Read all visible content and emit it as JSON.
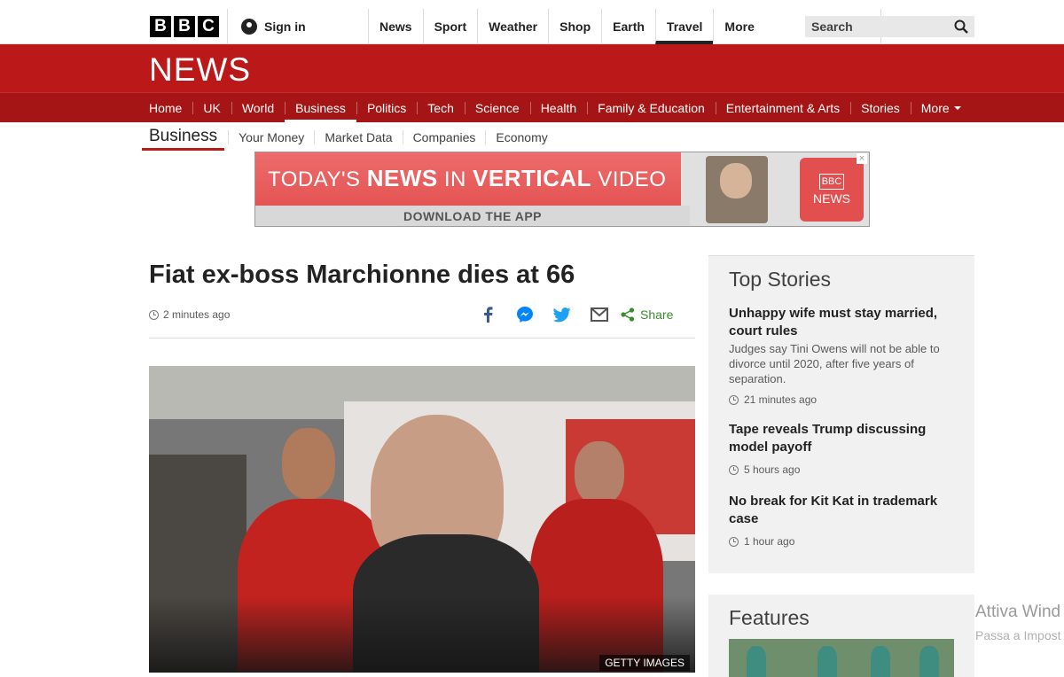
{
  "brand": {
    "logo_letters": [
      "B",
      "B",
      "C"
    ]
  },
  "account": {
    "signin_label": "Sign in"
  },
  "topnav": {
    "items": [
      "News",
      "Sport",
      "Weather",
      "Shop",
      "Earth",
      "Travel"
    ],
    "active": "Travel",
    "more_label": "More"
  },
  "search": {
    "placeholder": "Search"
  },
  "news_header": {
    "logo_text": "NEWS"
  },
  "section_nav": {
    "items": [
      "Home",
      "UK",
      "World",
      "Business",
      "Politics",
      "Tech",
      "Science",
      "Health",
      "Family & Education",
      "Entertainment & Arts",
      "Stories"
    ],
    "active": "Business",
    "more_label": "More"
  },
  "sub_nav": {
    "title": "Business",
    "items": [
      "Your Money",
      "Market Data",
      "Companies",
      "Economy"
    ]
  },
  "banner": {
    "line_prefix": "TODAY'S ",
    "line_bold1": "NEWS",
    "line_mid": " IN ",
    "line_bold2": "VERTICAL",
    "line_suffix": " VIDEO",
    "cta": "DOWNLOAD THE APP",
    "badge_top": "BBC",
    "badge_bottom": "NEWS",
    "close_label": "×"
  },
  "article": {
    "headline": "Fiat ex-boss Marchionne dies at 66",
    "timestamp": "2 minutes ago",
    "share_label": "Share",
    "image_credit": "GETTY IMAGES"
  },
  "top_stories": {
    "heading": "Top Stories",
    "stories": [
      {
        "title": "Unhappy wife must stay married, court rules",
        "summary": "Judges say Tini Owens will not be able to divorce until 2020, after five years of separation.",
        "time": "21 minutes ago"
      },
      {
        "title": "Tape reveals Trump discussing model payoff",
        "summary": "",
        "time": "5 hours ago"
      },
      {
        "title": "No break for Kit Kat in trademark case",
        "summary": "",
        "time": "1 hour ago"
      }
    ]
  },
  "features": {
    "heading": "Features"
  },
  "os_watermark": {
    "line1": "Attiva Wind",
    "line2": "Passa a Impost"
  },
  "colors": {
    "bbc_red": "#bb1919",
    "dark_red": "#a51515",
    "share_green": "#3a8c2c",
    "facebook": "#3b5998",
    "twitter": "#1da1f2"
  }
}
